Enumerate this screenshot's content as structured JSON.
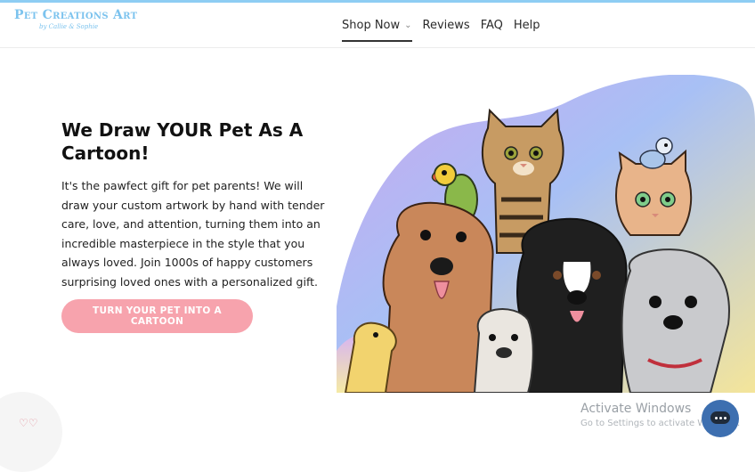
{
  "brand": {
    "name": "Pet Creations Art",
    "tagline": "by Callie & Sophie"
  },
  "nav": {
    "items": [
      {
        "label": "Shop Now",
        "has_dropdown": true,
        "active": true
      },
      {
        "label": "Reviews"
      },
      {
        "label": "FAQ"
      },
      {
        "label": "Help"
      }
    ]
  },
  "hero": {
    "title": "We Draw YOUR Pet As A Cartoon!",
    "body": "It's the pawfect gift for pet parents! We will draw your custom artwork by hand with tender care, love, and attention, turning them into an incredible masterpiece in the style that you always loved. Join 1000s of happy customers surprising loved ones with a personalized gift.",
    "cta": "TURN YOUR PET INTO A CARTOON"
  },
  "overlay": {
    "line1": "Activate Windows",
    "line2": "Go to Settings to activate Windows."
  },
  "colors": {
    "accent_blue": "#7cc3ee",
    "cta_pink": "#f7a3ad",
    "topbar": "#8ecdf3",
    "chat": "#3d6fb0"
  },
  "icons": {
    "chat": "chat-bubble-icon",
    "heart": "heart-icon",
    "dropdown": "chevron-down-icon"
  }
}
